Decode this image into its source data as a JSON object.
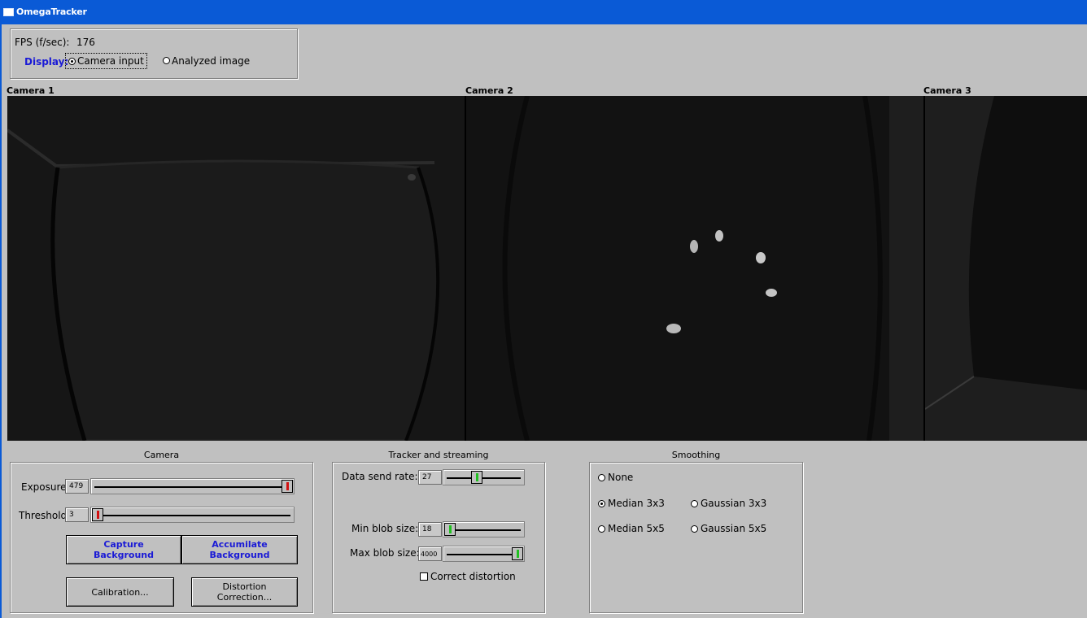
{
  "window": {
    "title": "OmegaTracker"
  },
  "status": {
    "fps_label": "FPS (f/sec):",
    "fps_value": "176"
  },
  "display": {
    "label": "Display:",
    "options": [
      "Camera input",
      "Analyzed image"
    ],
    "selected": "Camera input"
  },
  "cameras": [
    {
      "label": "Camera 1"
    },
    {
      "label": "Camera 2"
    },
    {
      "label": "Camera 3"
    }
  ],
  "camera_panel": {
    "title": "Camera",
    "exposure": {
      "label": "Exposure",
      "value": "479",
      "level": 1.0
    },
    "threshold": {
      "label": "Threshold",
      "value": "3",
      "level": 0.0
    },
    "capture_button": "Capture\nBackground",
    "accumulate_button": "Accumilate\nBackground",
    "calibration_button": "Calibration...",
    "distortion_button": "Distortion\nCorrection..."
  },
  "tracker_panel": {
    "title": "Tracker and streaming",
    "data_rate": {
      "label": "Data send rate:",
      "value": "27",
      "level": 0.4
    },
    "min_blob": {
      "label": "Min blob size:",
      "value": "18",
      "level": 0.0
    },
    "max_blob": {
      "label": "Max blob size:",
      "value": "4000",
      "level": 1.0
    },
    "correct_distortion": {
      "label": "Correct distortion",
      "checked": false
    }
  },
  "smoothing_panel": {
    "title": "Smoothing",
    "options": {
      "none": "None",
      "median3": "Median 3x3",
      "gauss3": "Gaussian 3x3",
      "median5": "Median 5x5",
      "gauss5": "Gaussian 5x5"
    },
    "selected": "Median 3x3"
  }
}
